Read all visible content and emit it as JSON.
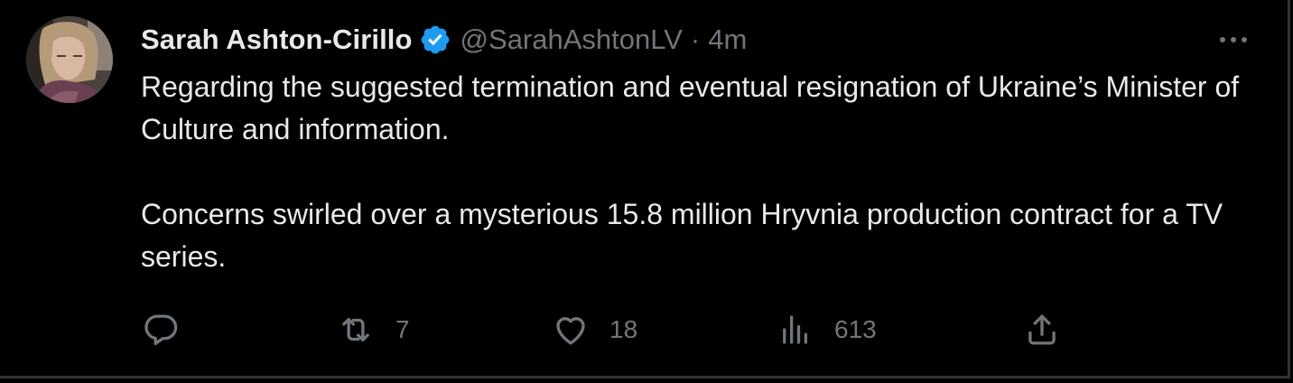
{
  "author": {
    "display_name": "Sarah Ashton-Cirillo",
    "handle": "@SarahAshtonLV",
    "separator": "·",
    "timestamp": "4m",
    "verified": true
  },
  "tweet": {
    "paragraphs": [
      "Regarding the suggested termination and eventual resignation of Ukraine’s Minister of Culture and information.",
      "Concerns swirled over a mysterious 15.8 million Hryvnia production contract for a TV series."
    ]
  },
  "actions": {
    "reply": {
      "icon": "reply-icon",
      "count": ""
    },
    "retweet": {
      "icon": "retweet-icon",
      "count": "7"
    },
    "like": {
      "icon": "heart-icon",
      "count": "18"
    },
    "views": {
      "icon": "views-icon",
      "count": "613"
    },
    "share": {
      "icon": "share-icon",
      "count": ""
    }
  },
  "colors": {
    "background": "#000000",
    "text_primary": "#e7e9ea",
    "text_secondary": "#71767b",
    "verified_blue": "#1d9bf0",
    "border": "#2f3336"
  }
}
